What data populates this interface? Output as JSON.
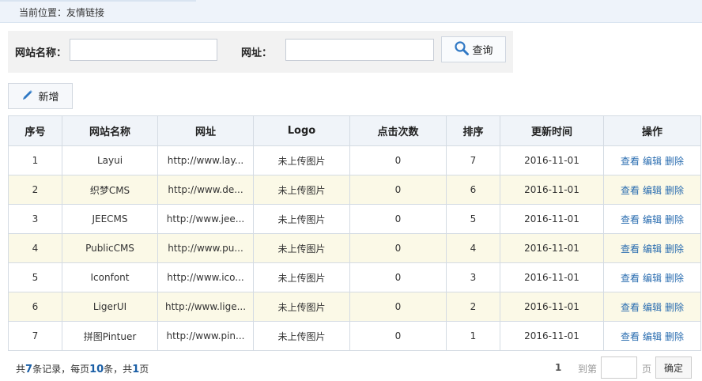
{
  "breadcrumb": "当前位置：友情链接",
  "search": {
    "name_label": "网站名称：",
    "url_label": "网址：",
    "name_value": "",
    "url_value": "",
    "button_label": "查询"
  },
  "toolbar": {
    "add_label": "新增"
  },
  "table": {
    "headers": [
      "序号",
      "网站名称",
      "网址",
      "Logo",
      "点击次数",
      "排序",
      "更新时间",
      "操作"
    ],
    "rows": [
      [
        "1",
        "Layui",
        "http://www.lay...",
        "未上传图片",
        "0",
        "7",
        "2016-11-01"
      ],
      [
        "2",
        "织梦CMS",
        "http://www.de...",
        "未上传图片",
        "0",
        "6",
        "2016-11-01"
      ],
      [
        "3",
        "JEECMS",
        "http://www.jee...",
        "未上传图片",
        "0",
        "5",
        "2016-11-01"
      ],
      [
        "4",
        "PublicCMS",
        "http://www.pu...",
        "未上传图片",
        "0",
        "4",
        "2016-11-01"
      ],
      [
        "5",
        "Iconfont",
        "http://www.ico...",
        "未上传图片",
        "0",
        "3",
        "2016-11-01"
      ],
      [
        "6",
        "LigerUI",
        "http://www.lige...",
        "未上传图片",
        "0",
        "2",
        "2016-11-01"
      ],
      [
        "7",
        "拼图Pintuer",
        "http://www.pin...",
        "未上传图片",
        "0",
        "1",
        "2016-11-01"
      ]
    ],
    "actions": [
      "查看",
      "编辑",
      "删除"
    ]
  },
  "footer": {
    "t1": "共",
    "total": "7",
    "t2": "条记录，每页",
    "per_page": "10",
    "t3": "条，共",
    "pages": "1",
    "t4": "页",
    "current_page": "1",
    "goto_label": "到第",
    "page_label": "页",
    "confirm_label": "确定"
  },
  "colors": {
    "accent": "#1b5fa6",
    "link": "#2a6db0",
    "row_alt": "#fbf9e7",
    "header_bg": "#f0f4f9"
  },
  "icons": {
    "search": "magnifier-icon",
    "add": "pencil-icon"
  }
}
